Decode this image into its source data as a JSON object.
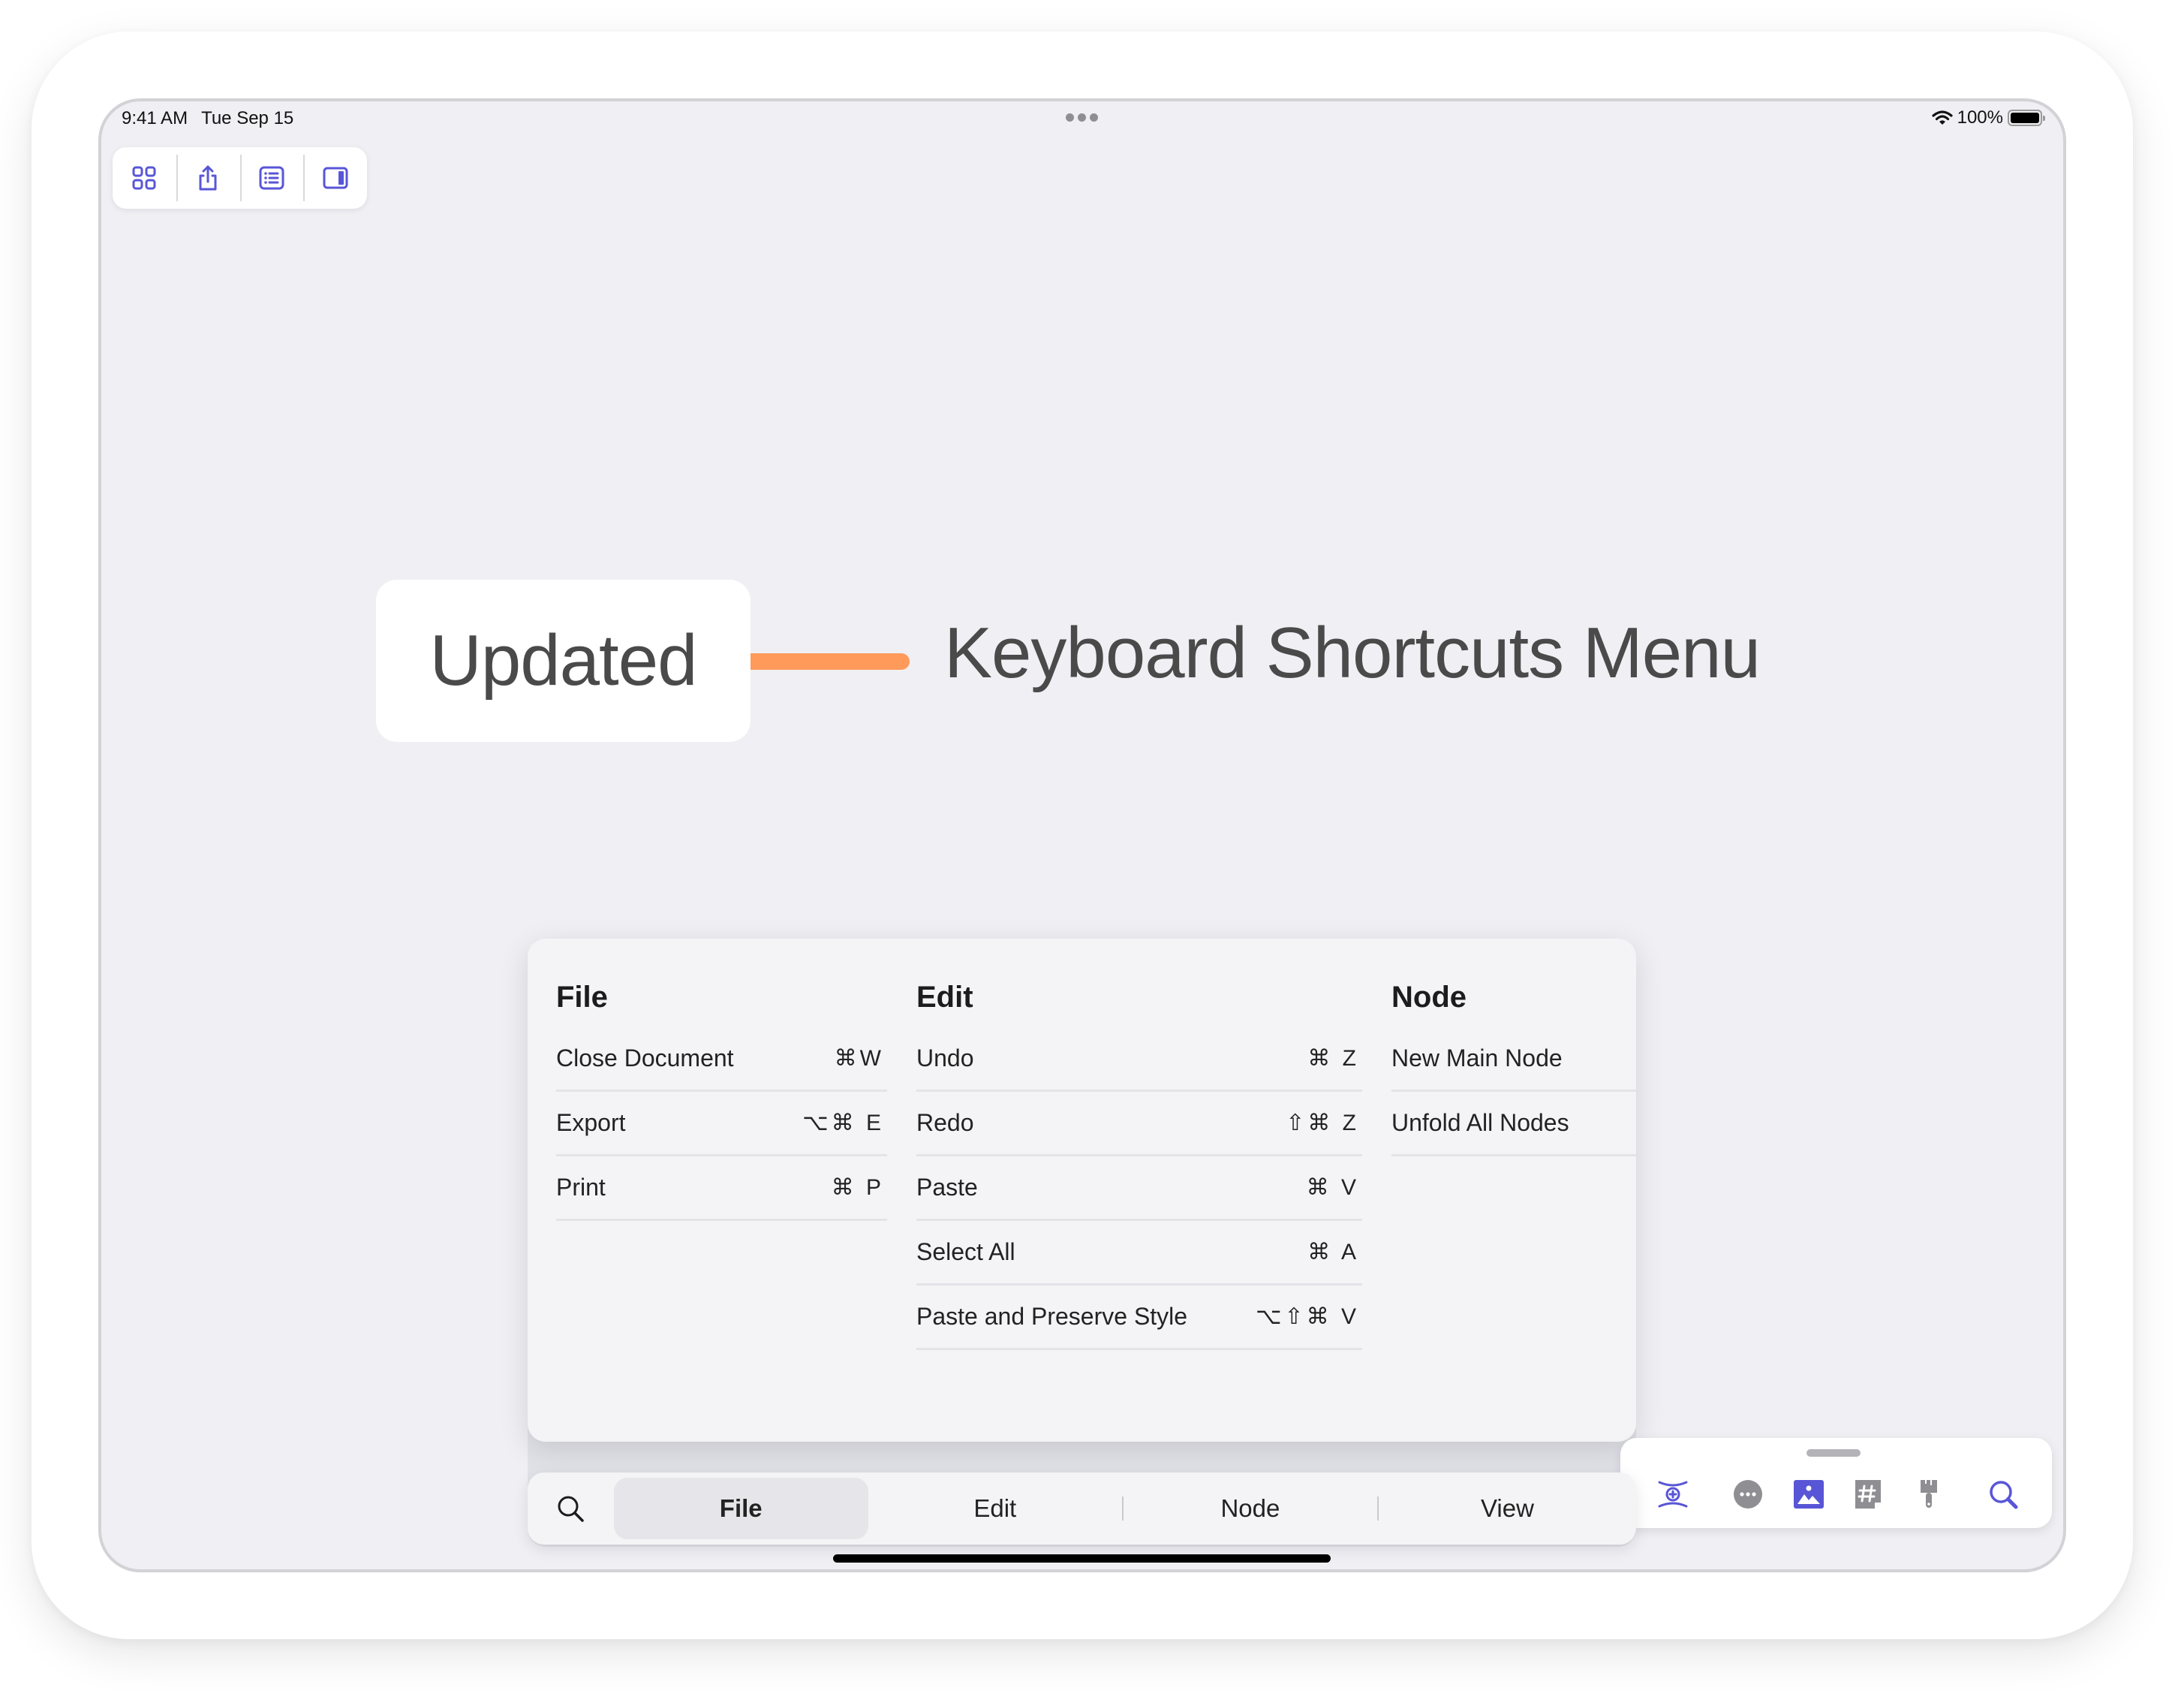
{
  "status_bar": {
    "time": "9:41 AM",
    "date": "Tue Sep 15",
    "battery_percent": "100%",
    "wifi_icon": "wifi-icon",
    "battery_icon": "battery-icon",
    "multitask_icon": "ellipsis-icon"
  },
  "top_toolbar": {
    "buttons": [
      {
        "name": "grid-icon",
        "label": "Browse"
      },
      {
        "name": "share-icon",
        "label": "Share"
      },
      {
        "name": "outline-icon",
        "label": "Outline"
      },
      {
        "name": "sidebar-icon",
        "label": "Inspector"
      }
    ]
  },
  "mindmap": {
    "main_node": "Updated",
    "child_node": "Keyboard Shortcuts Menu",
    "connector_color": "#FF9A5A"
  },
  "shortcuts": {
    "columns": [
      {
        "title": "File",
        "items": [
          {
            "label": "Close Document",
            "keys": "⌘W"
          },
          {
            "label": "Export",
            "keys": "⌥⌘ E"
          },
          {
            "label": "Print",
            "keys": "⌘ P"
          }
        ]
      },
      {
        "title": "Edit",
        "items": [
          {
            "label": "Undo",
            "keys": "⌘ Z"
          },
          {
            "label": "Redo",
            "keys": "⇧⌘ Z"
          },
          {
            "label": "Paste",
            "keys": "⌘ V"
          },
          {
            "label": "Select All",
            "keys": "⌘ A"
          },
          {
            "label": "Paste and Preserve Style",
            "keys": "⌥⇧⌘ V"
          }
        ]
      },
      {
        "title": "Node",
        "items": [
          {
            "label": "New Main Node",
            "keys": ""
          },
          {
            "label": "Unfold All Nodes",
            "keys": ""
          }
        ]
      }
    ]
  },
  "tab_bar": {
    "search_icon": "search-icon",
    "tabs": [
      "File",
      "Edit",
      "Node",
      "View"
    ],
    "active": "File"
  },
  "float_toolbar": {
    "icons": [
      "add-relationship-icon",
      "more-icon",
      "image-icon",
      "tag-icon",
      "format-brush-icon",
      "search-icon"
    ]
  },
  "colors": {
    "accent": "#5856D6",
    "icon_gray": "#8E8E93",
    "canvas": "#EFEFF4"
  }
}
